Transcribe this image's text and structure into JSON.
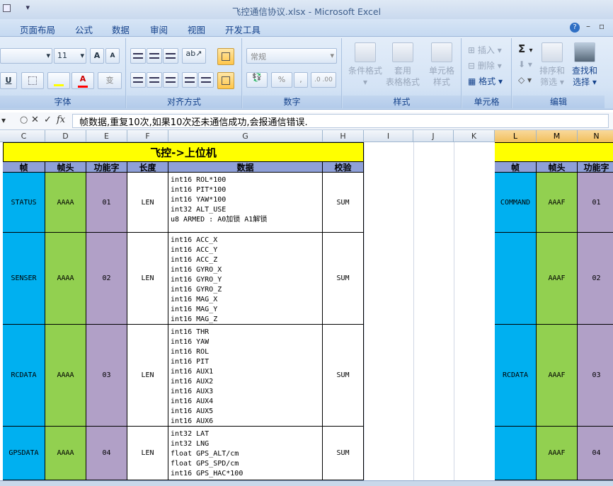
{
  "window": {
    "title": "飞控通信协议.xlsx - Microsoft Excel"
  },
  "menu": {
    "tabs": [
      "页面布局",
      "公式",
      "数据",
      "审阅",
      "视图",
      "开发工具"
    ]
  },
  "ribbon": {
    "font": {
      "label": "字体",
      "size": "11",
      "grow": "A",
      "shrink": "A",
      "underline": "U",
      "color": "A",
      "wen": "变"
    },
    "align": {
      "label": "对齐方式"
    },
    "number": {
      "label": "数字",
      "format": "常规",
      "percent": "%",
      "comma": ","
    },
    "styles": {
      "label": "样式",
      "conditional": "条件格式",
      "table": "套用",
      "table2": "表格格式",
      "cell": "单元格",
      "cell2": "样式"
    },
    "cells": {
      "label": "单元格",
      "insert": "插入",
      "delete": "删除",
      "format": "格式"
    },
    "edit": {
      "label": "编辑",
      "sigma": "Σ",
      "sort": "排序和",
      "sort2": "筛选",
      "find": "查找和",
      "find2": "选择"
    }
  },
  "formula_bar": {
    "fx": "fx",
    "text": "帧数据,重复10次,如果10次还未通信成功,会报通信错误."
  },
  "columns": [
    "C",
    "D",
    "E",
    "F",
    "G",
    "H",
    "I",
    "J",
    "K",
    "L",
    "M",
    "N"
  ],
  "table": {
    "title": "飞控->上位机",
    "headers": [
      "帧",
      "帧头",
      "功能字",
      "长度",
      "数据",
      "校验"
    ],
    "right_headers": [
      "帧",
      "帧头",
      "功能字"
    ],
    "rows": [
      {
        "frame": "STATUS",
        "head": "AAAA",
        "func": "01",
        "len": "LEN",
        "sum": "SUM",
        "data": [
          "int16 ROL*100",
          "int16 PIT*100",
          "int16 YAW*100",
          "int32 ALT_USE",
          "u8 ARMED : A0加锁 A1解锁"
        ],
        "rframe": "COMMAND",
        "rhead": "AAAF",
        "rfunc": "01"
      },
      {
        "frame": "SENSER",
        "head": "AAAA",
        "func": "02",
        "len": "LEN",
        "sum": "SUM",
        "data": [
          "int16 ACC_X",
          "int16 ACC_Y",
          "int16 ACC_Z",
          "int16 GYRO_X",
          "int16 GYRO_Y",
          "int16 GYRO_Z",
          "int16 MAG_X",
          "int16 MAG_Y",
          "int16 MAG_Z"
        ],
        "rframe": "",
        "rhead": "AAAF",
        "rfunc": "02"
      },
      {
        "frame": "RCDATA",
        "head": "AAAA",
        "func": "03",
        "len": "LEN",
        "sum": "SUM",
        "data": [
          "int16 THR",
          "int16 YAW",
          "int16 ROL",
          "int16 PIT",
          "int16 AUX1",
          "int16 AUX2",
          "int16 AUX3",
          "int16 AUX4",
          "int16 AUX5",
          "int16 AUX6"
        ],
        "rframe": "RCDATA",
        "rhead": "AAAF",
        "rfunc": "03"
      },
      {
        "frame": "GPSDATA",
        "head": "AAAA",
        "func": "04",
        "len": "LEN",
        "sum": "SUM",
        "data": [
          "int32 LAT",
          "int32 LNG",
          "float GPS_ALT/cm",
          "float GPS_SPD/cm",
          "int16 GPS_HAC*100"
        ],
        "rframe": "",
        "rhead": "AAAF",
        "rfunc": "04"
      }
    ]
  },
  "colors": {
    "title_bg": "#ffff00",
    "header_bg": "#8fa0d8",
    "frame_bg": "#00b0f0",
    "head_bg": "#92d050",
    "func_bg": "#b1a0c7"
  }
}
